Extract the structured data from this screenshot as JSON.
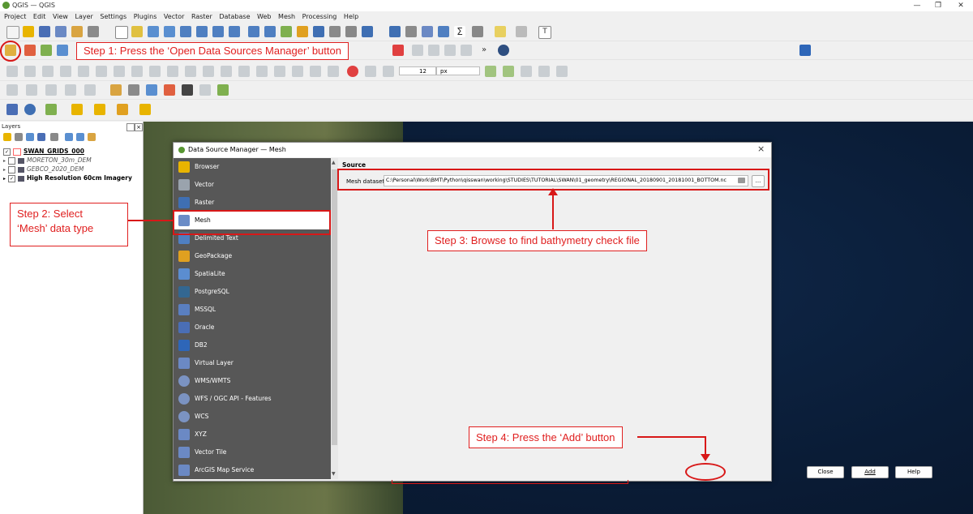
{
  "window": {
    "title": "QGIS — QGIS"
  },
  "menu": [
    "Project",
    "Edit",
    "View",
    "Layer",
    "Settings",
    "Plugins",
    "Vector",
    "Raster",
    "Database",
    "Web",
    "Mesh",
    "Processing",
    "Help"
  ],
  "toolbar": {
    "font_size_value": "12",
    "font_unit": "px"
  },
  "layers_panel": {
    "title": "Layers",
    "layers": [
      {
        "name": "SWAN_GRIDS_000",
        "checked": true,
        "style": "bold-underline",
        "color": "#ff6666"
      },
      {
        "name": "MORETON_30m_DEM",
        "checked": false,
        "style": "italic"
      },
      {
        "name": "GEBCO_2020_DEM",
        "checked": false,
        "style": "italic"
      },
      {
        "name": "High Resolution 60cm Imagery",
        "checked": true,
        "style": "bold"
      }
    ]
  },
  "dialog": {
    "title": "Data Source Manager — Mesh",
    "close_label": "×",
    "source_types": [
      {
        "label": "Browser",
        "color": "#e8b400"
      },
      {
        "label": "Vector",
        "color": "#9aa3ad"
      },
      {
        "label": "Raster",
        "color": "#3f6fb3"
      },
      {
        "label": "Mesh",
        "color": "#6a8cc7"
      },
      {
        "label": "Delimited Text",
        "color": "#4f7fc1"
      },
      {
        "label": "GeoPackage",
        "color": "#e0a020"
      },
      {
        "label": "SpatiaLite",
        "color": "#5b8dd0"
      },
      {
        "label": "PostgreSQL",
        "color": "#336791"
      },
      {
        "label": "MSSQL",
        "color": "#5a7fc0"
      },
      {
        "label": "Oracle",
        "color": "#4a6eb5"
      },
      {
        "label": "DB2",
        "color": "#2e66b8"
      },
      {
        "label": "Virtual Layer",
        "color": "#6b89c4"
      },
      {
        "label": "WMS/WMTS",
        "color": "#7b93c2"
      },
      {
        "label": "WFS / OGC API - Features",
        "color": "#7b93c2"
      },
      {
        "label": "WCS",
        "color": "#7b93c2"
      },
      {
        "label": "XYZ",
        "color": "#6b89c4"
      },
      {
        "label": "Vector Tile",
        "color": "#6b89c4"
      },
      {
        "label": "ArcGIS Map Service",
        "color": "#6b89c4"
      }
    ],
    "selected_type": "Mesh",
    "source_heading": "Source",
    "mesh_dataset_label": "Mesh dataset",
    "mesh_dataset_value": "C:\\Personal\\Work\\BMT\\Python\\qisswan\\working\\STUDIES\\TUTORIAL\\SWAN\\01_geometry\\REGIONAL_20180901_20181001_BOTTOM.nc",
    "browse_label": "...",
    "buttons": {
      "close": "Close",
      "add": "Add",
      "help": "Help"
    }
  },
  "annotations": {
    "step1": "Step 1: Press the ‘Open Data Sources Manager’ button",
    "step2_line1": "Step 2: Select",
    "step2_line2": "‘Mesh’ data type",
    "step3": "Step 3: Browse to find bathymetry check file",
    "step4": "Step 4: Press the ‘Add’ button"
  }
}
